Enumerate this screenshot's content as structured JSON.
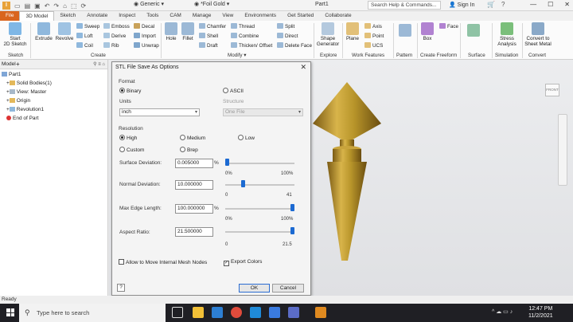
{
  "titlebar": {
    "logo": "I",
    "material": "Generic",
    "appearance": "*Foil Gold",
    "document": "Part1",
    "search_placeholder": "Search Help & Commands...",
    "sign_in": "Sign In"
  },
  "tabs": [
    "File",
    "3D Model",
    "Sketch",
    "Annotate",
    "Inspect",
    "Tools",
    "CAM",
    "Manage",
    "View",
    "Environments",
    "Get Started",
    "Collaborate"
  ],
  "ribbon": {
    "start_sketch": "Start\n2D Sketch",
    "sketch_group": "Sketch",
    "extrude": "Extrude",
    "revolve": "Revolve",
    "sweep": "Sweep",
    "loft": "Loft",
    "coil": "Coil",
    "emboss": "Emboss",
    "derive": "Derive",
    "rib": "Rib",
    "decal": "Decal",
    "import": "Import",
    "unwrap": "Unwrap",
    "create_group": "Create",
    "hole": "Hole",
    "fillet": "Fillet",
    "chamfer": "Chamfer",
    "shell": "Shell",
    "draft": "Draft",
    "thread": "Thread",
    "combine": "Combine",
    "thicken": "Thicken/ Offset",
    "split": "Split",
    "direct": "Direct",
    "delete_face": "Delete Face",
    "modify_group": "Modify",
    "shape_generator": "Shape\nGenerator",
    "explore_group": "Explore",
    "plane": "Plane",
    "axis": "Axis",
    "point": "Point",
    "ucs": "UCS",
    "work_features_group": "Work Features",
    "pattern_group": "Pattern",
    "box": "Box",
    "face": "Face",
    "create_freeform_group": "Create Freeform",
    "surface_group": "Surface",
    "stress_analysis": "Stress\nAnalysis",
    "simulation_group": "Simulation",
    "convert_sheet_metal": "Convert to\nSheet Metal",
    "convert_group": "Convert"
  },
  "browser": {
    "tab": "Model",
    "tree": [
      "Part1",
      "Solid Bodies(1)",
      "View: Master",
      "Origin",
      "Revolution1",
      "End of Part"
    ]
  },
  "dialog": {
    "title": "STL File Save As Options",
    "format_label": "Format",
    "binary": "Binary",
    "ascii": "ASCII",
    "units_label": "Units",
    "units_value": "inch",
    "structure_label": "Structure",
    "structure_value": "One File",
    "resolution_label": "Resolution",
    "res_high": "High",
    "res_medium": "Medium",
    "res_low": "Low",
    "res_custom": "Custom",
    "res_brep": "Brep",
    "surface_deviation_label": "Surface Deviation:",
    "surface_deviation_value": "0.005000",
    "surface_deviation_unit": "%",
    "surface_deviation_min": "0%",
    "surface_deviation_max": "100%",
    "surface_deviation_level": 0.0,
    "normal_deviation_label": "Normal Deviation:",
    "normal_deviation_value": "10.000000",
    "normal_deviation_min": "0",
    "normal_deviation_max": "41",
    "normal_deviation_level": 0.24,
    "max_edge_label": "Max Edge Length:",
    "max_edge_value": "100.000000",
    "max_edge_unit": "%",
    "max_edge_min": "0%",
    "max_edge_max": "100%",
    "max_edge_level": 1.0,
    "aspect_ratio_label": "Aspect Ratio:",
    "aspect_ratio_value": "21.500000",
    "aspect_ratio_min": "0",
    "aspect_ratio_max": "21.5",
    "aspect_ratio_level": 1.0,
    "allow_internal": "Allow to Move Internal Mesh Nodes",
    "export_colors": "Export Colors",
    "ok": "OK",
    "cancel": "Cancel",
    "help": "?"
  },
  "status": "Ready",
  "taskbar": {
    "search": "Type here to search",
    "time": "12:47 PM",
    "date": "11/2/2021"
  },
  "colors": {
    "file_tab": "#d9651f",
    "slider_thumb": "#1c6ad2",
    "gold": "#b8952a"
  }
}
